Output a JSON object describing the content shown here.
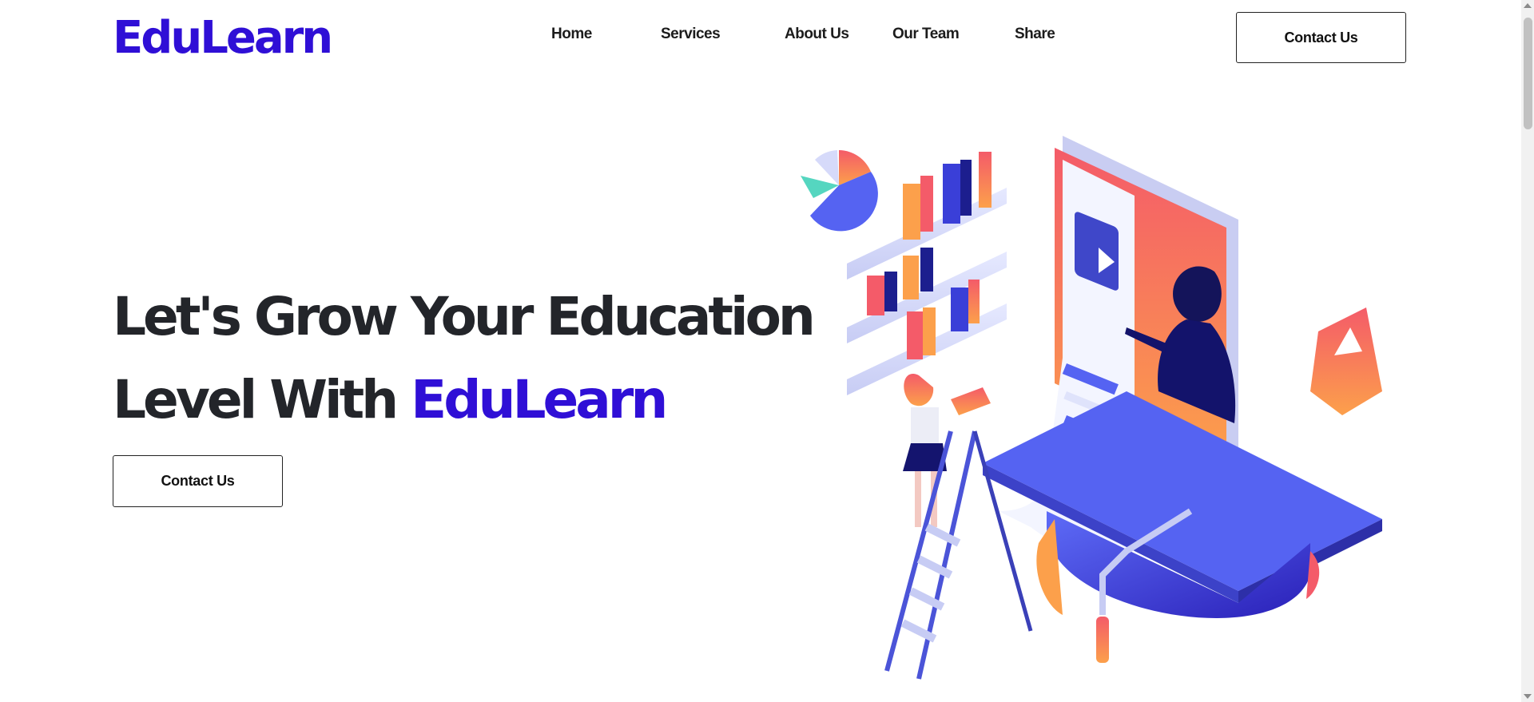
{
  "brand": {
    "name": "EduLearn"
  },
  "nav": {
    "items": [
      {
        "label": "Home"
      },
      {
        "label": "Services"
      },
      {
        "label": "About Us"
      },
      {
        "label": "Our Team"
      },
      {
        "label": "Share"
      }
    ],
    "cta_label": "Contact Us"
  },
  "hero": {
    "title_line1": "Let's Grow Your Education",
    "title_line2_prefix": "Level With ",
    "title_line2_accent": "EduLearn",
    "cta_label": "Contact Us"
  },
  "illustration": {
    "icon": "education-illustration"
  },
  "colors": {
    "brand": "#2f0fd6",
    "text": "#23252a",
    "illustration_blue": "#4f5cf0",
    "illustration_orange": "#fca04b",
    "illustration_pink": "#f45b69"
  }
}
